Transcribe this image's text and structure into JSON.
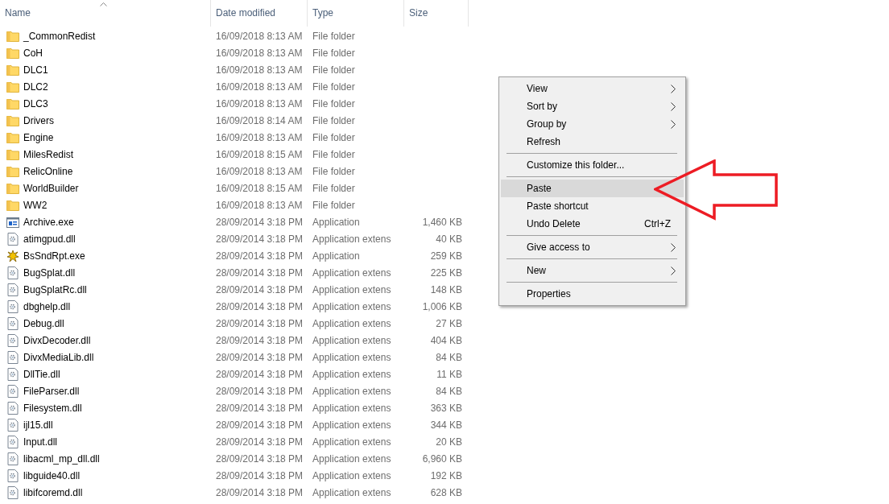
{
  "file_list": {
    "columns": [
      {
        "label": "Name",
        "sorted": true
      },
      {
        "label": "Date modified",
        "sorted": false
      },
      {
        "label": "Type",
        "sorted": false
      },
      {
        "label": "Size",
        "sorted": false
      }
    ],
    "rows": [
      {
        "kind": "folder",
        "name": "_CommonRedist",
        "date": "16/09/2018 8:13 AM",
        "type": "File folder"
      },
      {
        "kind": "folder",
        "name": "CoH",
        "date": "16/09/2018 8:13 AM",
        "type": "File folder"
      },
      {
        "kind": "folder",
        "name": "DLC1",
        "date": "16/09/2018 8:13 AM",
        "type": "File folder"
      },
      {
        "kind": "folder",
        "name": "DLC2",
        "date": "16/09/2018 8:13 AM",
        "type": "File folder"
      },
      {
        "kind": "folder",
        "name": "DLC3",
        "date": "16/09/2018 8:13 AM",
        "type": "File folder"
      },
      {
        "kind": "folder",
        "name": "Drivers",
        "date": "16/09/2018 8:14 AM",
        "type": "File folder"
      },
      {
        "kind": "folder",
        "name": "Engine",
        "date": "16/09/2018 8:13 AM",
        "type": "File folder"
      },
      {
        "kind": "folder",
        "name": "MilesRedist",
        "date": "16/09/2018 8:15 AM",
        "type": "File folder"
      },
      {
        "kind": "folder",
        "name": "RelicOnline",
        "date": "16/09/2018 8:13 AM",
        "type": "File folder"
      },
      {
        "kind": "folder",
        "name": "WorldBuilder",
        "date": "16/09/2018 8:15 AM",
        "type": "File folder"
      },
      {
        "kind": "folder",
        "name": "WW2",
        "date": "16/09/2018 8:13 AM",
        "type": "File folder"
      },
      {
        "kind": "app",
        "name": "Archive.exe",
        "date": "28/09/2014 3:18 PM",
        "type": "Application",
        "size": "1,460 KB"
      },
      {
        "kind": "dll",
        "name": "atimgpud.dll",
        "date": "28/09/2014 3:18 PM",
        "type": "Application extens",
        "size": "40 KB"
      },
      {
        "kind": "bug",
        "name": "BsSndRpt.exe",
        "date": "28/09/2014 3:18 PM",
        "type": "Application",
        "size": "259 KB"
      },
      {
        "kind": "dll",
        "name": "BugSplat.dll",
        "date": "28/09/2014 3:18 PM",
        "type": "Application extens",
        "size": "225 KB"
      },
      {
        "kind": "dll",
        "name": "BugSplatRc.dll",
        "date": "28/09/2014 3:18 PM",
        "type": "Application extens",
        "size": "148 KB"
      },
      {
        "kind": "dll",
        "name": "dbghelp.dll",
        "date": "28/09/2014 3:18 PM",
        "type": "Application extens",
        "size": "1,006 KB"
      },
      {
        "kind": "dll",
        "name": "Debug.dll",
        "date": "28/09/2014 3:18 PM",
        "type": "Application extens",
        "size": "27 KB"
      },
      {
        "kind": "dll",
        "name": "DivxDecoder.dll",
        "date": "28/09/2014 3:18 PM",
        "type": "Application extens",
        "size": "404 KB"
      },
      {
        "kind": "dll",
        "name": "DivxMediaLib.dll",
        "date": "28/09/2014 3:18 PM",
        "type": "Application extens",
        "size": "84 KB"
      },
      {
        "kind": "dll",
        "name": "DllTie.dll",
        "date": "28/09/2014 3:18 PM",
        "type": "Application extens",
        "size": "11 KB"
      },
      {
        "kind": "dll",
        "name": "FileParser.dll",
        "date": "28/09/2014 3:18 PM",
        "type": "Application extens",
        "size": "84 KB"
      },
      {
        "kind": "dll",
        "name": "Filesystem.dll",
        "date": "28/09/2014 3:18 PM",
        "type": "Application extens",
        "size": "363 KB"
      },
      {
        "kind": "dll",
        "name": "ijl15.dll",
        "date": "28/09/2014 3:18 PM",
        "type": "Application extens",
        "size": "344 KB"
      },
      {
        "kind": "dll",
        "name": "Input.dll",
        "date": "28/09/2014 3:18 PM",
        "type": "Application extens",
        "size": "20 KB"
      },
      {
        "kind": "dll",
        "name": "libacml_mp_dll.dll",
        "date": "28/09/2014 3:18 PM",
        "type": "Application extens",
        "size": "6,960 KB"
      },
      {
        "kind": "dll",
        "name": "libguide40.dll",
        "date": "28/09/2014 3:18 PM",
        "type": "Application extens",
        "size": "192 KB"
      },
      {
        "kind": "dll",
        "name": "libifcoremd.dll",
        "date": "28/09/2014 3:18 PM",
        "type": "Application extens",
        "size": "628 KB"
      }
    ]
  },
  "context_menu": {
    "items": [
      {
        "kind": "item",
        "label": "View",
        "submenu": true,
        "selected": false
      },
      {
        "kind": "item",
        "label": "Sort by",
        "submenu": true,
        "selected": false
      },
      {
        "kind": "item",
        "label": "Group by",
        "submenu": true,
        "selected": false
      },
      {
        "kind": "item",
        "label": "Refresh",
        "submenu": false,
        "selected": false
      },
      {
        "kind": "separator"
      },
      {
        "kind": "item",
        "label": "Customize this folder...",
        "submenu": false,
        "selected": false
      },
      {
        "kind": "separator"
      },
      {
        "kind": "item",
        "label": "Paste",
        "submenu": false,
        "selected": true
      },
      {
        "kind": "item",
        "label": "Paste shortcut",
        "submenu": false,
        "selected": false
      },
      {
        "kind": "item",
        "label": "Undo Delete",
        "shortcut": "Ctrl+Z",
        "submenu": false,
        "selected": false
      },
      {
        "kind": "separator"
      },
      {
        "kind": "item",
        "label": "Give access to",
        "submenu": true,
        "selected": false
      },
      {
        "kind": "separator"
      },
      {
        "kind": "item",
        "label": "New",
        "submenu": true,
        "selected": false
      },
      {
        "kind": "separator"
      },
      {
        "kind": "item",
        "label": "Properties",
        "submenu": false,
        "selected": false
      }
    ]
  },
  "annotation": {
    "kind": "arrow",
    "color": "#ed1c24"
  }
}
